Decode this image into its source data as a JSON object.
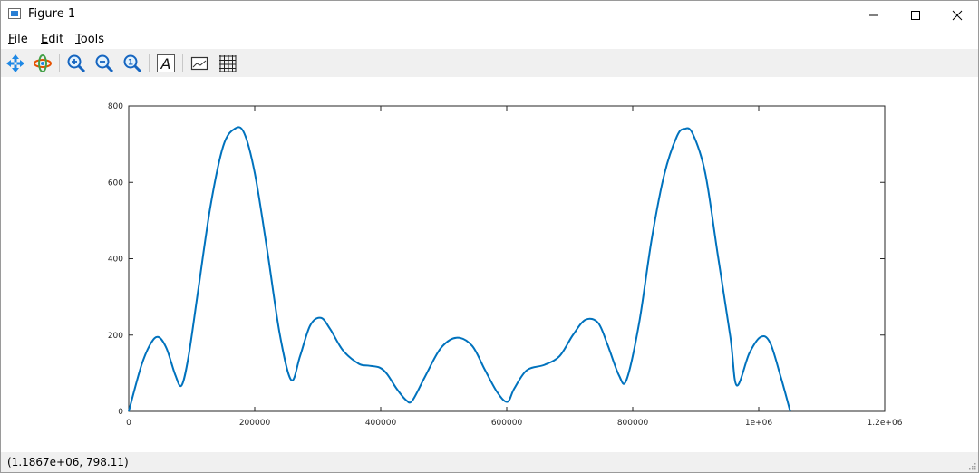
{
  "window": {
    "title": "Figure 1"
  },
  "window_controls": {
    "minimize": "—",
    "maximize": "☐",
    "close": "✕"
  },
  "menu": [
    {
      "label_ul": "F",
      "label_rest": "ile"
    },
    {
      "label_ul": "E",
      "label_rest": "dit"
    },
    {
      "label_ul": "T",
      "label_rest": "ools"
    }
  ],
  "toolbar": {
    "icons": [
      "pan-icon",
      "rotate-icon",
      "zoom-in-icon",
      "zoom-out-icon",
      "zoom-reset-icon",
      "text-insert-icon",
      "axes-toggle-icon",
      "grid-toggle-icon"
    ]
  },
  "status": {
    "coords": "(1.1867e+06, 798.11)"
  },
  "colors": {
    "line": "#0072bd",
    "axes": "#262626"
  },
  "chart_data": {
    "type": "line",
    "title": "",
    "xlabel": "",
    "ylabel": "",
    "xlim": [
      0,
      1200000
    ],
    "ylim": [
      0,
      800
    ],
    "xticks": [
      0,
      200000,
      400000,
      600000,
      800000,
      1000000,
      1200000
    ],
    "xtick_labels": [
      "0",
      "200000",
      "400000",
      "600000",
      "800000",
      "1e+06",
      "1.2e+06"
    ],
    "yticks": [
      0,
      200,
      400,
      600,
      800
    ],
    "ytick_labels": [
      "0",
      "200",
      "400",
      "600",
      "800"
    ],
    "grid": false,
    "series": [
      {
        "x": [
          0,
          20000,
          35000,
          47000,
          60000,
          74000,
          84000,
          95000,
          110000,
          130000,
          150000,
          168000,
          183000,
          200000,
          220000,
          240000,
          258000,
          272000,
          288000,
          305000,
          320000,
          340000,
          365000,
          380000,
          398000,
          410000,
          425000,
          440000,
          450000,
          470000,
          495000,
          520000,
          545000,
          565000,
          585000,
          601000,
          612000,
          632000,
          660000,
          684000,
          705000,
          725000,
          745000,
          760000,
          778000,
          790000,
          810000,
          830000,
          850000,
          870000,
          882000,
          895000,
          915000,
          935000,
          955000,
          965000,
          985000,
          1003000,
          1018000,
          1035000,
          1050000
        ],
        "y": [
          0,
          120,
          178,
          195,
          165,
          95,
          68,
          145,
          315,
          540,
          695,
          740,
          730,
          625,
          420,
          200,
          82,
          145,
          225,
          245,
          215,
          160,
          125,
          120,
          115,
          98,
          60,
          30,
          28,
          90,
          165,
          193,
          172,
          110,
          50,
          25,
          60,
          108,
          122,
          145,
          200,
          240,
          232,
          175,
          95,
          82,
          230,
          450,
          620,
          720,
          740,
          728,
          625,
          410,
          195,
          68,
          152,
          195,
          180,
          90,
          0
        ]
      }
    ]
  }
}
